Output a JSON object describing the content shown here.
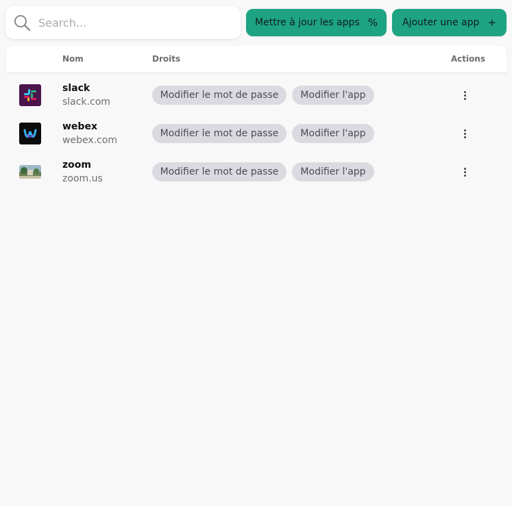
{
  "search": {
    "placeholder": "Search..."
  },
  "toolbar": {
    "update_label": "Mettre à jour les apps",
    "update_icon": "percent-icon",
    "add_label": "Ajouter une app",
    "add_icon": "plus-icon"
  },
  "table": {
    "headers": {
      "name": "Nom",
      "rights": "Droits",
      "actions": "Actions"
    },
    "rows": [
      {
        "name": "slack",
        "domain": "slack.com",
        "rights": [
          "Modifier le mot de passe",
          "Modifier l'app"
        ],
        "icon": "slack-logo-icon"
      },
      {
        "name": "webex",
        "domain": "webex.com",
        "rights": [
          "Modifier le mot de passe",
          "Modifier l'app"
        ],
        "icon": "webex-logo-icon"
      },
      {
        "name": "zoom",
        "domain": "zoom.us",
        "rights": [
          "Modifier le mot de passe",
          "Modifier l'app"
        ],
        "icon": "zoom-logo-icon"
      }
    ]
  },
  "colors": {
    "accent": "#1ea383",
    "chip_bg": "#dcdae0",
    "background": "#f8f8f9"
  }
}
